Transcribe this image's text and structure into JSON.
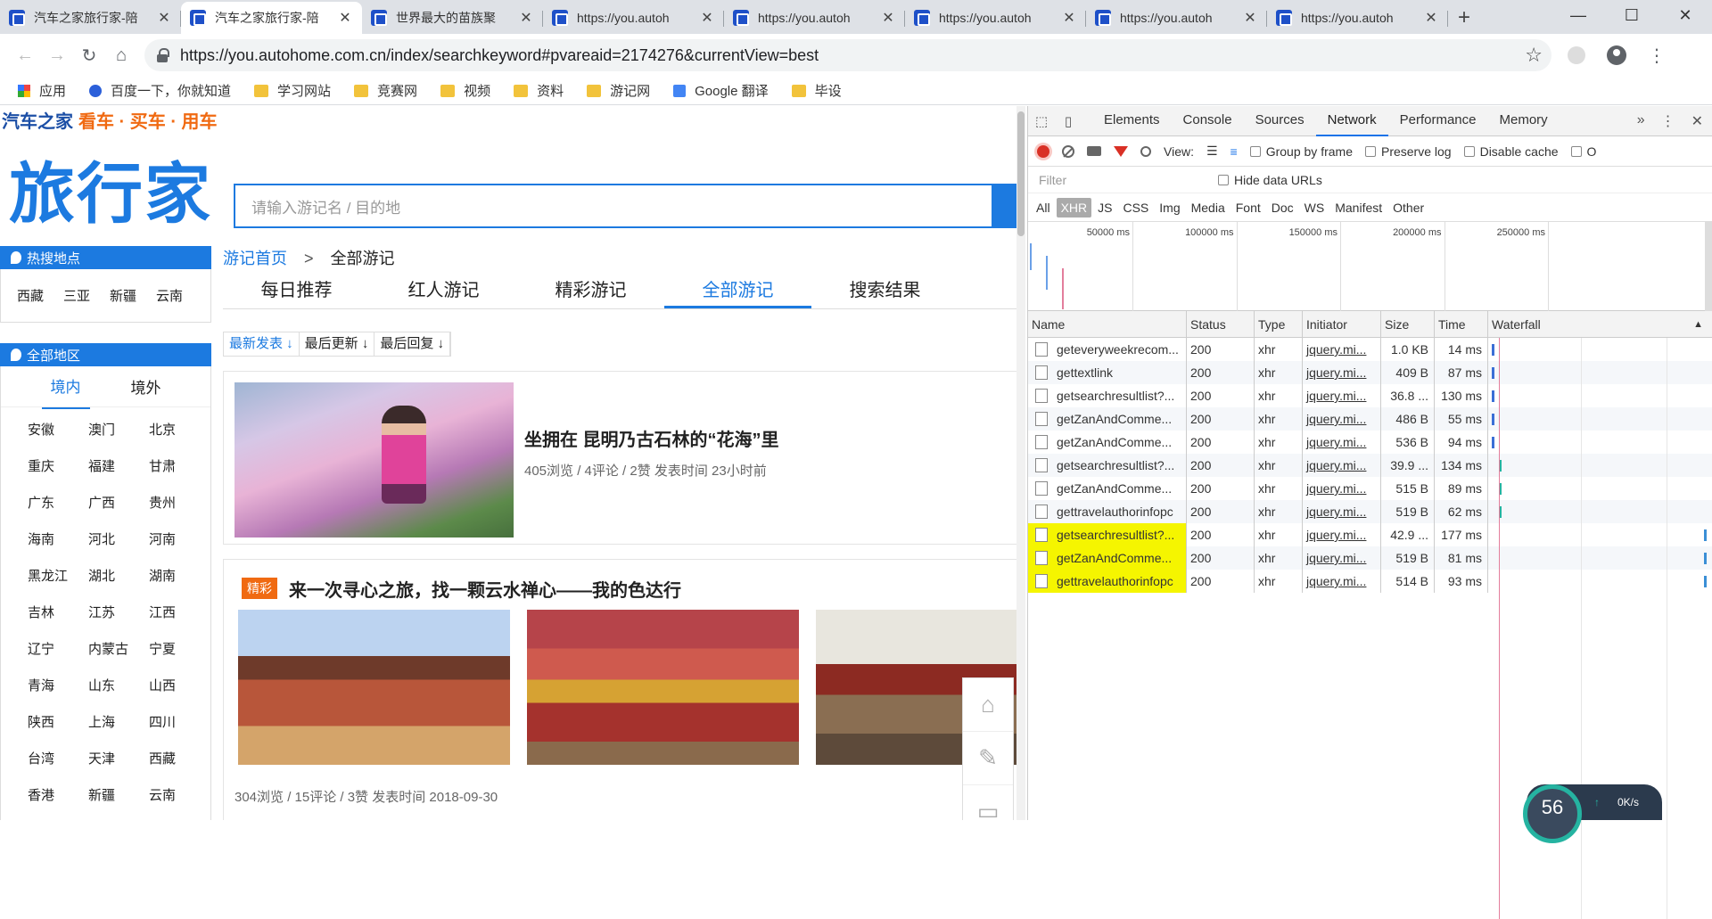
{
  "tabs": [
    {
      "title": "汽车之家旅行家-陪",
      "active": false
    },
    {
      "title": "汽车之家旅行家-陪",
      "active": true
    },
    {
      "title": "世界最大的苗族聚",
      "active": false
    },
    {
      "title": "https://you.autoh",
      "active": false
    },
    {
      "title": "https://you.autoh",
      "active": false
    },
    {
      "title": "https://you.autoh",
      "active": false
    },
    {
      "title": "https://you.autoh",
      "active": false
    },
    {
      "title": "https://you.autoh",
      "active": false
    }
  ],
  "window_controls": {
    "minimize": "—",
    "maximize": "☐",
    "close": "✕"
  },
  "nav": {
    "back": "←",
    "forward": "→",
    "reload": "↻",
    "home": "⌂",
    "star": "☆",
    "menu": "⋮"
  },
  "omnibox": {
    "url": "https://you.autohome.com.cn/index/searchkeyword#pvareaid=2174276&currentView=best"
  },
  "bookmarks": [
    {
      "label": "应用",
      "icon": "apps"
    },
    {
      "label": "百度一下，你就知道",
      "icon": "baidu"
    },
    {
      "label": "学习网站",
      "icon": "folder"
    },
    {
      "label": "竞赛网",
      "icon": "folder"
    },
    {
      "label": "视频",
      "icon": "folder"
    },
    {
      "label": "资料",
      "icon": "folder"
    },
    {
      "label": "游记网",
      "icon": "folder"
    },
    {
      "label": "Google 翻译",
      "icon": "gt"
    },
    {
      "label": "毕设",
      "icon": "folder"
    }
  ],
  "site": {
    "brand": "汽车之家",
    "slogan": "看车 · 买车 · 用车",
    "logo": "旅行家",
    "search_placeholder": "请输入游记名 / 目的地",
    "hot_title": "热搜地点",
    "hot_places": [
      "西藏",
      "三亚",
      "新疆",
      "云南"
    ],
    "region_title": "全部地区",
    "region_tabs": [
      "境内",
      "境外"
    ],
    "provinces": [
      "安徽",
      "澳门",
      "北京",
      "重庆",
      "福建",
      "甘肃",
      "广东",
      "广西",
      "贵州",
      "海南",
      "河北",
      "河南",
      "黑龙江",
      "湖北",
      "湖南",
      "吉林",
      "江苏",
      "江西",
      "辽宁",
      "内蒙古",
      "宁夏",
      "青海",
      "山东",
      "山西",
      "陕西",
      "上海",
      "四川",
      "台湾",
      "天津",
      "西藏",
      "香港",
      "新疆",
      "云南"
    ],
    "breadcrumb": {
      "home": "游记首页",
      "sep": ">",
      "current": "全部游记"
    },
    "main_tabs": [
      "每日推荐",
      "红人游记",
      "精彩游记",
      "全部游记",
      "搜索结果"
    ],
    "sort": [
      "最新发表 ↓",
      "最后更新 ↓",
      "最后回复 ↓"
    ],
    "card1": {
      "title": "坐拥在 昆明乃古石林的“花海”里",
      "meta": "405浏览 / 4评论 / 2赞   发表时间  23小时前"
    },
    "card2": {
      "badge": "精彩",
      "title": "来一次寻心之旅，找一颗云水禅心——我的色达行",
      "meta": "304浏览 / 15评论 / 3赞   发表时间  2018-09-30"
    },
    "float": [
      "⌂",
      "✎",
      "▭"
    ]
  },
  "devtools": {
    "tabs": [
      "Elements",
      "Console",
      "Sources",
      "Network",
      "Performance",
      "Memory"
    ],
    "more": "»",
    "view_label": "View:",
    "checkboxes": [
      "Group by frame",
      "Preserve log",
      "Disable cache",
      "O"
    ],
    "filter_placeholder": "Filter",
    "hide_data_urls": "Hide data URLs",
    "types": [
      "All",
      "XHR",
      "JS",
      "CSS",
      "Img",
      "Media",
      "Font",
      "Doc",
      "WS",
      "Manifest",
      "Other"
    ],
    "ticks": [
      "50000 ms",
      "100000 ms",
      "150000 ms",
      "200000 ms",
      "250000 ms"
    ],
    "columns": [
      "Name",
      "Status",
      "Type",
      "Initiator",
      "Size",
      "Time",
      "Waterfall"
    ],
    "sort_arrow": "▲",
    "rows": [
      {
        "name": "geteveryweekrecom...",
        "status": "200",
        "type": "xhr",
        "initiator": "jquery.mi...",
        "size": "1.0 KB",
        "time": "14 ms",
        "hl": false
      },
      {
        "name": "gettextlink",
        "status": "200",
        "type": "xhr",
        "initiator": "jquery.mi...",
        "size": "409 B",
        "time": "87 ms",
        "hl": false
      },
      {
        "name": "getsearchresultlist?...",
        "status": "200",
        "type": "xhr",
        "initiator": "jquery.mi...",
        "size": "36.8 ...",
        "time": "130 ms",
        "hl": false
      },
      {
        "name": "getZanAndComme...",
        "status": "200",
        "type": "xhr",
        "initiator": "jquery.mi...",
        "size": "486 B",
        "time": "55 ms",
        "hl": false
      },
      {
        "name": "getZanAndComme...",
        "status": "200",
        "type": "xhr",
        "initiator": "jquery.mi...",
        "size": "536 B",
        "time": "94 ms",
        "hl": false
      },
      {
        "name": "getsearchresultlist?...",
        "status": "200",
        "type": "xhr",
        "initiator": "jquery.mi...",
        "size": "39.9 ...",
        "time": "134 ms",
        "hl": false
      },
      {
        "name": "getZanAndComme...",
        "status": "200",
        "type": "xhr",
        "initiator": "jquery.mi...",
        "size": "515 B",
        "time": "89 ms",
        "hl": false
      },
      {
        "name": "gettravelauthorinfopc",
        "status": "200",
        "type": "xhr",
        "initiator": "jquery.mi...",
        "size": "519 B",
        "time": "62 ms",
        "hl": false
      },
      {
        "name": "getsearchresultlist?...",
        "status": "200",
        "type": "xhr",
        "initiator": "jquery.mi...",
        "size": "42.9 ...",
        "time": "177 ms",
        "hl": true
      },
      {
        "name": "getZanAndComme...",
        "status": "200",
        "type": "xhr",
        "initiator": "jquery.mi...",
        "size": "519 B",
        "time": "81 ms",
        "hl": true
      },
      {
        "name": "gettravelauthorinfopc",
        "status": "200",
        "type": "xhr",
        "initiator": "jquery.mi...",
        "size": "514 B",
        "time": "93 ms",
        "hl": true
      }
    ]
  },
  "speed": {
    "value": "56",
    "rate": "0K/s"
  },
  "colors": {
    "accent": "#1c7ae0",
    "orange": "#f06a12",
    "highlight": "#f5f500",
    "record": "#d93025"
  }
}
